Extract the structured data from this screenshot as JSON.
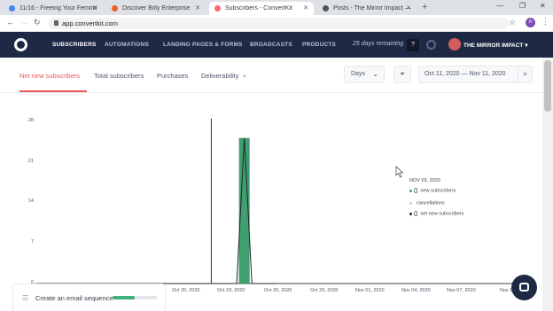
{
  "browser": {
    "tabs": [
      {
        "title": "11/16 - Freeing Your Feminine",
        "favicon_color": "#4285f4",
        "active": false
      },
      {
        "title": "Discover Bitly Enterprise",
        "favicon_color": "#ee6123",
        "active": false
      },
      {
        "title": "Subscribers - ConvertKit",
        "favicon_color": "#fb6970",
        "active": true
      },
      {
        "title": "Posts - The Mirror Impact — Wo",
        "favicon_color": "#555555",
        "active": false
      }
    ],
    "url": "app.convertkit.com",
    "profile_initial": "A"
  },
  "app_nav": {
    "items": [
      "SUBSCRIBERS",
      "AUTOMATIONS",
      "LANDING PAGES & FORMS",
      "BROADCASTS",
      "PRODUCTS"
    ],
    "trial": "25 days remaining",
    "help": "?",
    "account": "THE MIRROR IMPACT ▾"
  },
  "subnav": {
    "tabs": [
      "Net new subscribers",
      "Total subscribers",
      "Purchases",
      "Deliverability"
    ],
    "period": "Days",
    "date_range": "Oct 11, 2020  —  Nov 11, 2020"
  },
  "chart_data": {
    "type": "bar",
    "series": [
      {
        "name": "new subscribers",
        "color": "#3f9f6e",
        "values": [
          0,
          0,
          0,
          0,
          0,
          0,
          0,
          0,
          0,
          0,
          0,
          0,
          0,
          0,
          0,
          0,
          0,
          0,
          0,
          0,
          0,
          0,
          0,
          0,
          0,
          0,
          0,
          25,
          0,
          0,
          0,
          0
        ]
      }
    ],
    "net_line": [
      0,
      0,
      0,
      0,
      0,
      0,
      0,
      0,
      0,
      0,
      0,
      0,
      0,
      0,
      0,
      0,
      0,
      0,
      0,
      0,
      0,
      0,
      0,
      0,
      0,
      0,
      0,
      25,
      0,
      0,
      0,
      0
    ],
    "y_ticks": [
      "28",
      "21",
      "14",
      "7",
      "0"
    ],
    "ylim": [
      0,
      28
    ],
    "x_ticks": [
      "Oct 20, 2020",
      "Oct 23, 2020",
      "Oct 26, 2020",
      "Oct 29, 2020",
      "Nov 01, 2020",
      "Nov 04, 2020",
      "Nov 07, 2020",
      "Nov 10"
    ],
    "hover_date": "Nov 03, 2020"
  },
  "tooltip": {
    "date": "NOV 03, 2020",
    "rows": [
      {
        "value": "0",
        "label": "new subscribers",
        "color": "#3f9f6e"
      },
      {
        "value": "",
        "label": "cancellations",
        "color": "#c8ccd2"
      },
      {
        "value": "0",
        "label": "net new subscribers",
        "color": "#1e2a45"
      }
    ]
  },
  "onboarding": {
    "label": "Create an email sequence",
    "progress": 0.5
  },
  "colors": {
    "accent": "#e8575a",
    "navy": "#1e2a45",
    "green": "#3f9f6e"
  }
}
